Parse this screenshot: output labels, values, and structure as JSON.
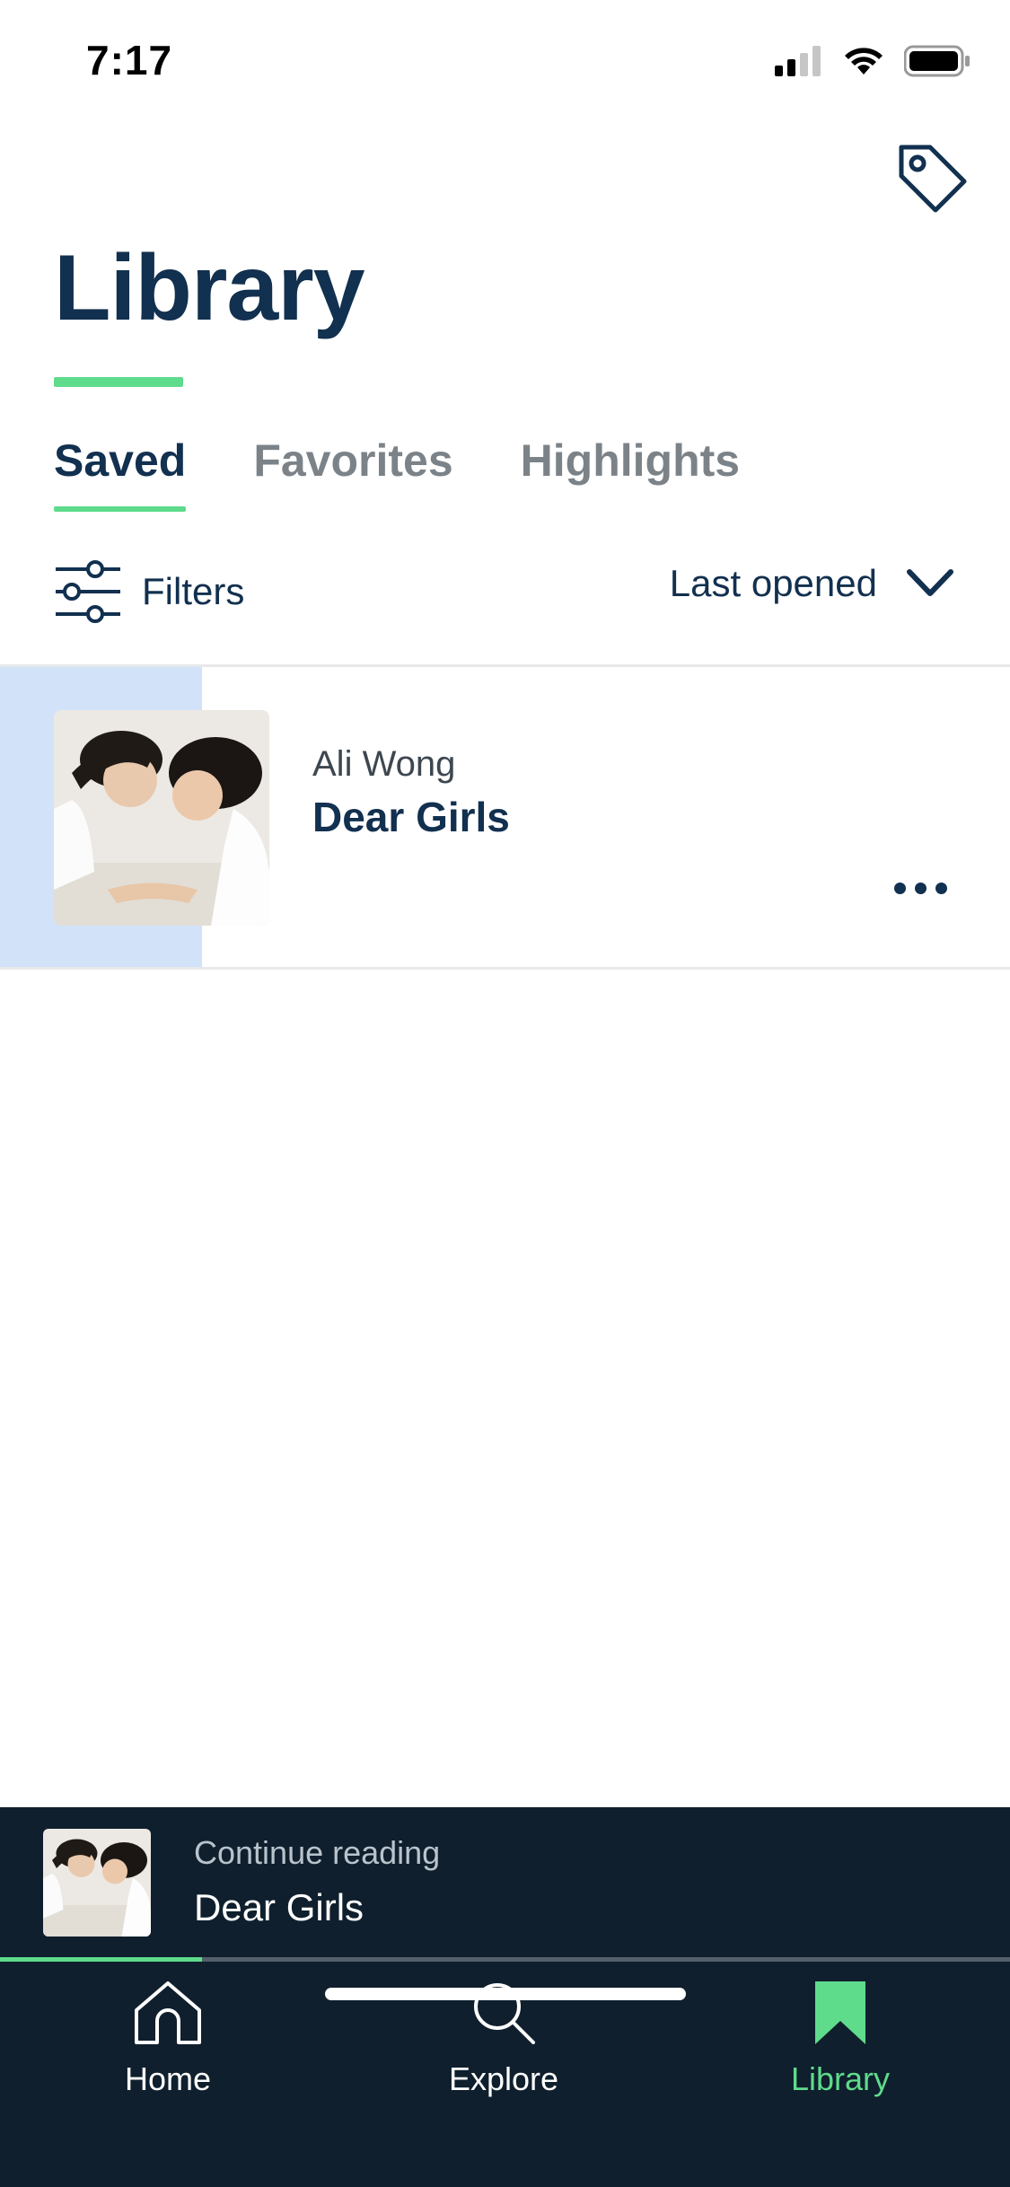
{
  "status_bar": {
    "time": "7:17",
    "icons": [
      "cellular-signal-icon",
      "wifi-icon",
      "battery-icon"
    ]
  },
  "header": {
    "title": "Library",
    "tag_icon": "tag-icon"
  },
  "tabs": [
    {
      "label": "Saved",
      "active": true
    },
    {
      "label": "Favorites",
      "active": false
    },
    {
      "label": "Highlights",
      "active": false
    }
  ],
  "filters": {
    "label": "Filters",
    "icon": "sliders-icon",
    "sort_label": "Last opened",
    "sort_icon": "chevron-down-icon"
  },
  "books": [
    {
      "author": "Ali Wong",
      "title": "Dear Girls",
      "progress_fraction": 0.2,
      "more_icon": "more-dots-icon"
    }
  ],
  "continue_reading": {
    "caption": "Continue reading",
    "title": "Dear Girls",
    "progress_fraction": 0.2
  },
  "tab_bar": {
    "items": [
      {
        "label": "Home",
        "icon": "home-icon",
        "active": false
      },
      {
        "label": "Explore",
        "icon": "search-icon",
        "active": false
      },
      {
        "label": "Library",
        "icon": "bookmark-icon",
        "active": true
      }
    ]
  },
  "colors": {
    "accent_green": "#5fdb8c",
    "navy": "#12304f",
    "dark_bar": "#0f1f2d",
    "progress_blue": "#d2e2f8"
  }
}
